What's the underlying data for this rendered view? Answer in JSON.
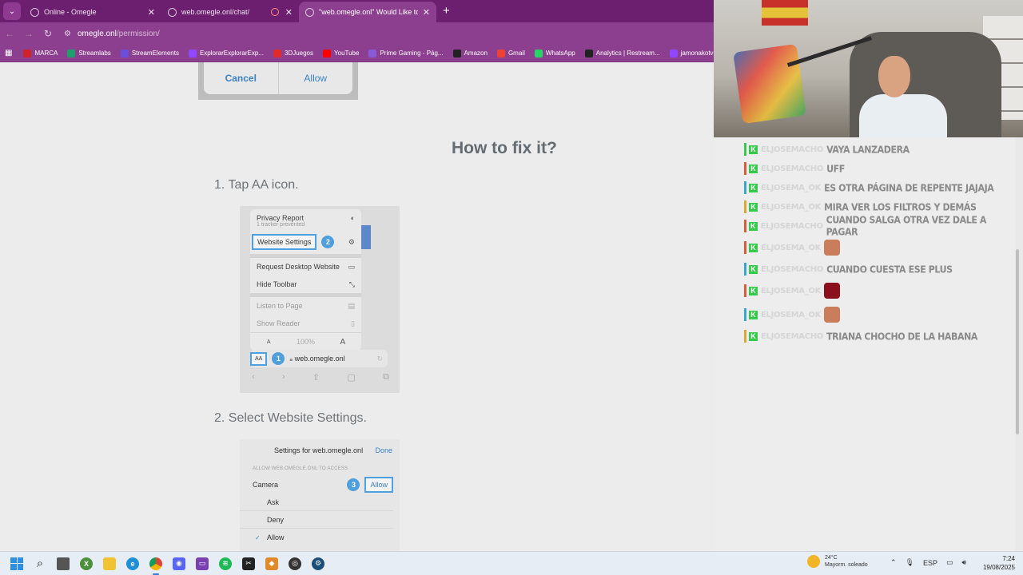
{
  "browser": {
    "tabs": [
      {
        "label": "Online - Omegle",
        "active": false
      },
      {
        "label": "web.omegle.onl/chat/",
        "active": false
      },
      {
        "label": "\"web.omegle.onl\" Would Like to",
        "active": true
      }
    ],
    "url_host": "omegle.onl",
    "url_path": "/permission/",
    "bookmarks": [
      {
        "label": "MARCA",
        "icon": "marca-icon",
        "color": "#d2232a"
      },
      {
        "label": "Streamlabs",
        "icon": "streamlabs-icon",
        "color": "#1f9e6c"
      },
      {
        "label": "StreamElements",
        "icon": "streamelements-icon",
        "color": "#6b4fd8"
      },
      {
        "label": "ExplorarExplorarExp...",
        "icon": "twitch-icon",
        "color": "#9146ff"
      },
      {
        "label": "3DJuegos",
        "icon": "3djuegos-icon",
        "color": "#e02b2b"
      },
      {
        "label": "YouTube",
        "icon": "youtube-icon",
        "color": "#ff0000"
      },
      {
        "label": "Prime Gaming - Pág...",
        "icon": "prime-gaming-icon",
        "color": "#8a5ad6"
      },
      {
        "label": "Amazon",
        "icon": "amazon-icon",
        "color": "#222222"
      },
      {
        "label": "Gmail",
        "icon": "gmail-icon",
        "color": "#ea4335"
      },
      {
        "label": "WhatsApp",
        "icon": "whatsapp-icon",
        "color": "#25d366"
      },
      {
        "label": "Analytics | Restream...",
        "icon": "restream-icon",
        "color": "#222222"
      },
      {
        "label": "jamonakotv - T",
        "icon": "twitch-icon",
        "color": "#9146ff"
      }
    ]
  },
  "page": {
    "dialog": {
      "cancel": "Cancel",
      "allow": "Allow"
    },
    "fix_title": "How to fix it?",
    "step1": "1. Tap AA icon.",
    "step2": "2. Select Website Settings.",
    "menu": {
      "privacy_report": "Privacy Report",
      "tracker_note": "1 tracker prevented",
      "website_settings": "Website Settings",
      "badge2": "2",
      "request_desktop": "Request Desktop Website",
      "hide_toolbar": "Hide Toolbar",
      "listen_to_page": "Listen to Page",
      "show_reader": "Show Reader",
      "zoom_small": "A",
      "zoom_level": "100%",
      "zoom_large": "A",
      "aa_label": "AA",
      "badge1": "1",
      "address": "web.omegle.onl"
    },
    "settings": {
      "title": "Settings for web.omegle.onl",
      "done": "Done",
      "caption": "ALLOW WEB.OMEGLE.ONL TO ACCESS",
      "camera": "Camera",
      "badge3": "3",
      "allow": "Allow",
      "options": [
        "Ask",
        "Deny",
        "Allow"
      ]
    }
  },
  "chat": {
    "messages": [
      {
        "user": "ELJOSEMACHO",
        "text": "VAYA LANZADERA",
        "bar": "#38c94e"
      },
      {
        "user": "ELJOSEMACHO",
        "text": "UFF",
        "bar": "#e05a3a"
      },
      {
        "user": "ELJOSEMA_OK",
        "text": "ES OTRA PÁGINA DE REPENTE JAJAJA",
        "bar": "#3aa3d9"
      },
      {
        "user": "ELJOSEMA_OK",
        "text": "MIRA VER LOS FILTROS Y DEMÁS",
        "bar": "#e0a53a"
      },
      {
        "user": "ELJOSEMACHO",
        "text": "CUANDO SALGA OTRA VEZ DALE A PAGAR",
        "bar": "#e05a3a"
      },
      {
        "user": "ELJOSEMA_OK",
        "text": "",
        "bar": "#e05a3a",
        "emote": "#c97d5a"
      },
      {
        "user": "ELJOSEMACHO",
        "text": "CUANDO CUESTA ESE PLUS",
        "bar": "#3aa3d9"
      },
      {
        "user": "ELJOSEMA_OK",
        "text": "",
        "bar": "#e05a3a",
        "emote": "#8a1020"
      },
      {
        "user": "ELJOSEMA_OK",
        "text": "",
        "bar": "#3aa3d9",
        "emote": "#c97d5a"
      },
      {
        "user": "ELJOSEMACHO",
        "text": "TRIANA CHOCHO DE LA HABANA",
        "bar": "#e0a53a"
      }
    ]
  },
  "taskbar": {
    "temperature": "24°C",
    "weather": "Mayorm. soleado",
    "language": "ESP",
    "time": "7:24",
    "date": "19/08/2025"
  }
}
